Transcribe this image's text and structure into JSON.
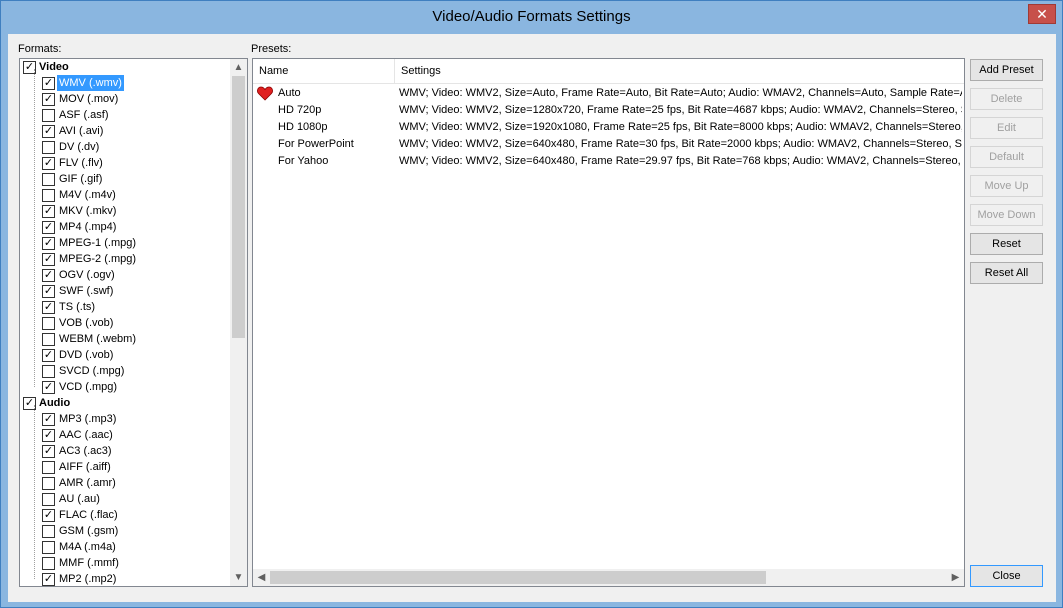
{
  "window": {
    "title": "Video/Audio Formats Settings",
    "close_glyph": "✕"
  },
  "labels": {
    "formats": "Formats:",
    "presets": "Presets:"
  },
  "formats": {
    "groups": [
      {
        "label": "Video",
        "checked": true,
        "items": [
          {
            "label": "WMV (.wmv)",
            "checked": true,
            "selected": true
          },
          {
            "label": "MOV (.mov)",
            "checked": true
          },
          {
            "label": "ASF (.asf)",
            "checked": false
          },
          {
            "label": "AVI (.avi)",
            "checked": true
          },
          {
            "label": "DV (.dv)",
            "checked": false
          },
          {
            "label": "FLV (.flv)",
            "checked": true
          },
          {
            "label": "GIF (.gif)",
            "checked": false
          },
          {
            "label": "M4V (.m4v)",
            "checked": false
          },
          {
            "label": "MKV (.mkv)",
            "checked": true
          },
          {
            "label": "MP4 (.mp4)",
            "checked": true
          },
          {
            "label": "MPEG-1 (.mpg)",
            "checked": true
          },
          {
            "label": "MPEG-2 (.mpg)",
            "checked": true
          },
          {
            "label": "OGV (.ogv)",
            "checked": true
          },
          {
            "label": "SWF (.swf)",
            "checked": true
          },
          {
            "label": "TS (.ts)",
            "checked": true
          },
          {
            "label": "VOB (.vob)",
            "checked": false
          },
          {
            "label": "WEBM (.webm)",
            "checked": false
          },
          {
            "label": "DVD (.vob)",
            "checked": true
          },
          {
            "label": "SVCD (.mpg)",
            "checked": false
          },
          {
            "label": "VCD (.mpg)",
            "checked": true
          }
        ]
      },
      {
        "label": "Audio",
        "checked": true,
        "items": [
          {
            "label": "MP3 (.mp3)",
            "checked": true
          },
          {
            "label": "AAC (.aac)",
            "checked": true
          },
          {
            "label": "AC3 (.ac3)",
            "checked": true
          },
          {
            "label": "AIFF (.aiff)",
            "checked": false
          },
          {
            "label": "AMR (.amr)",
            "checked": false
          },
          {
            "label": "AU (.au)",
            "checked": false
          },
          {
            "label": "FLAC (.flac)",
            "checked": true
          },
          {
            "label": "GSM (.gsm)",
            "checked": false
          },
          {
            "label": "M4A (.m4a)",
            "checked": false
          },
          {
            "label": "MMF (.mmf)",
            "checked": false
          },
          {
            "label": "MP2 (.mp2)",
            "checked": true
          }
        ]
      }
    ]
  },
  "presets": {
    "columns": {
      "name": "Name",
      "settings": "Settings"
    },
    "rows": [
      {
        "name": "Auto",
        "default": true,
        "settings": "WMV; Video: WMV2, Size=Auto, Frame Rate=Auto, Bit Rate=Auto; Audio: WMAV2, Channels=Auto, Sample Rate=Auto"
      },
      {
        "name": "HD 720p",
        "default": false,
        "settings": "WMV; Video: WMV2, Size=1280x720, Frame Rate=25 fps, Bit Rate=4687 kbps; Audio: WMAV2, Channels=Stereo, Sample Rate"
      },
      {
        "name": "HD 1080p",
        "default": false,
        "settings": "WMV; Video: WMV2, Size=1920x1080, Frame Rate=25 fps, Bit Rate=8000 kbps; Audio: WMAV2, Channels=Stereo, Sample"
      },
      {
        "name": "For PowerPoint",
        "default": false,
        "settings": "WMV; Video: WMV2, Size=640x480, Frame Rate=30 fps, Bit Rate=2000 kbps; Audio: WMAV2, Channels=Stereo, Sample Rate"
      },
      {
        "name": "For Yahoo",
        "default": false,
        "settings": "WMV; Video: WMV2, Size=640x480, Frame Rate=29.97 fps, Bit Rate=768 kbps; Audio: WMAV2, Channels=Stereo, Sample"
      }
    ]
  },
  "buttons": [
    {
      "label": "Add Preset",
      "enabled": true
    },
    {
      "label": "Delete",
      "enabled": false
    },
    {
      "label": "Edit",
      "enabled": false
    },
    {
      "label": "Default",
      "enabled": false
    },
    {
      "label": "Move Up",
      "enabled": false
    },
    {
      "label": "Move Down",
      "enabled": false
    },
    {
      "label": "Reset",
      "enabled": true
    },
    {
      "label": "Reset All",
      "enabled": true
    }
  ],
  "close_button": "Close",
  "colors": {
    "titlebar": "#8ab6e0",
    "selection": "#3399ff",
    "heart": "#e02020"
  }
}
